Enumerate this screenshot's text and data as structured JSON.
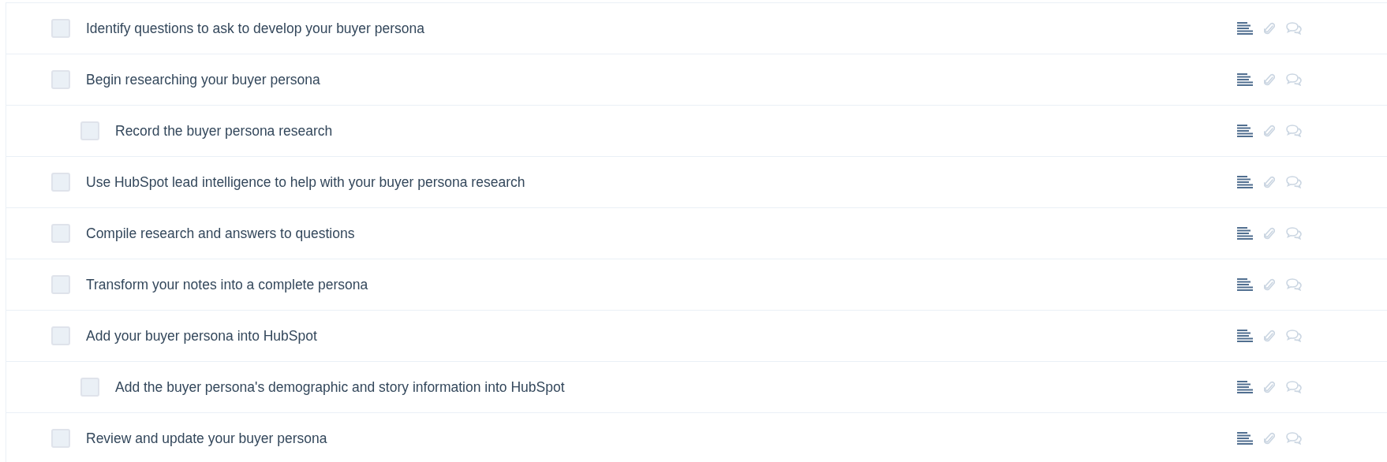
{
  "tasks": [
    {
      "label": "Identify questions to ask to develop your buyer persona",
      "checked": false
    },
    {
      "label": "Begin researching your buyer persona",
      "checked": false,
      "children": [
        {
          "label": "Record the buyer persona research",
          "checked": false
        }
      ]
    },
    {
      "label": "Use HubSpot lead intelligence to help with your buyer persona research",
      "checked": false
    },
    {
      "label": "Compile research and answers to questions",
      "checked": false
    },
    {
      "label": "Transform your notes into a complete persona",
      "checked": false
    },
    {
      "label": "Add your buyer persona into HubSpot",
      "checked": false,
      "children": [
        {
          "label": "Add the buyer persona's demographic and story information into HubSpot",
          "checked": false
        }
      ]
    },
    {
      "label": "Review and update your buyer persona",
      "checked": false
    }
  ]
}
